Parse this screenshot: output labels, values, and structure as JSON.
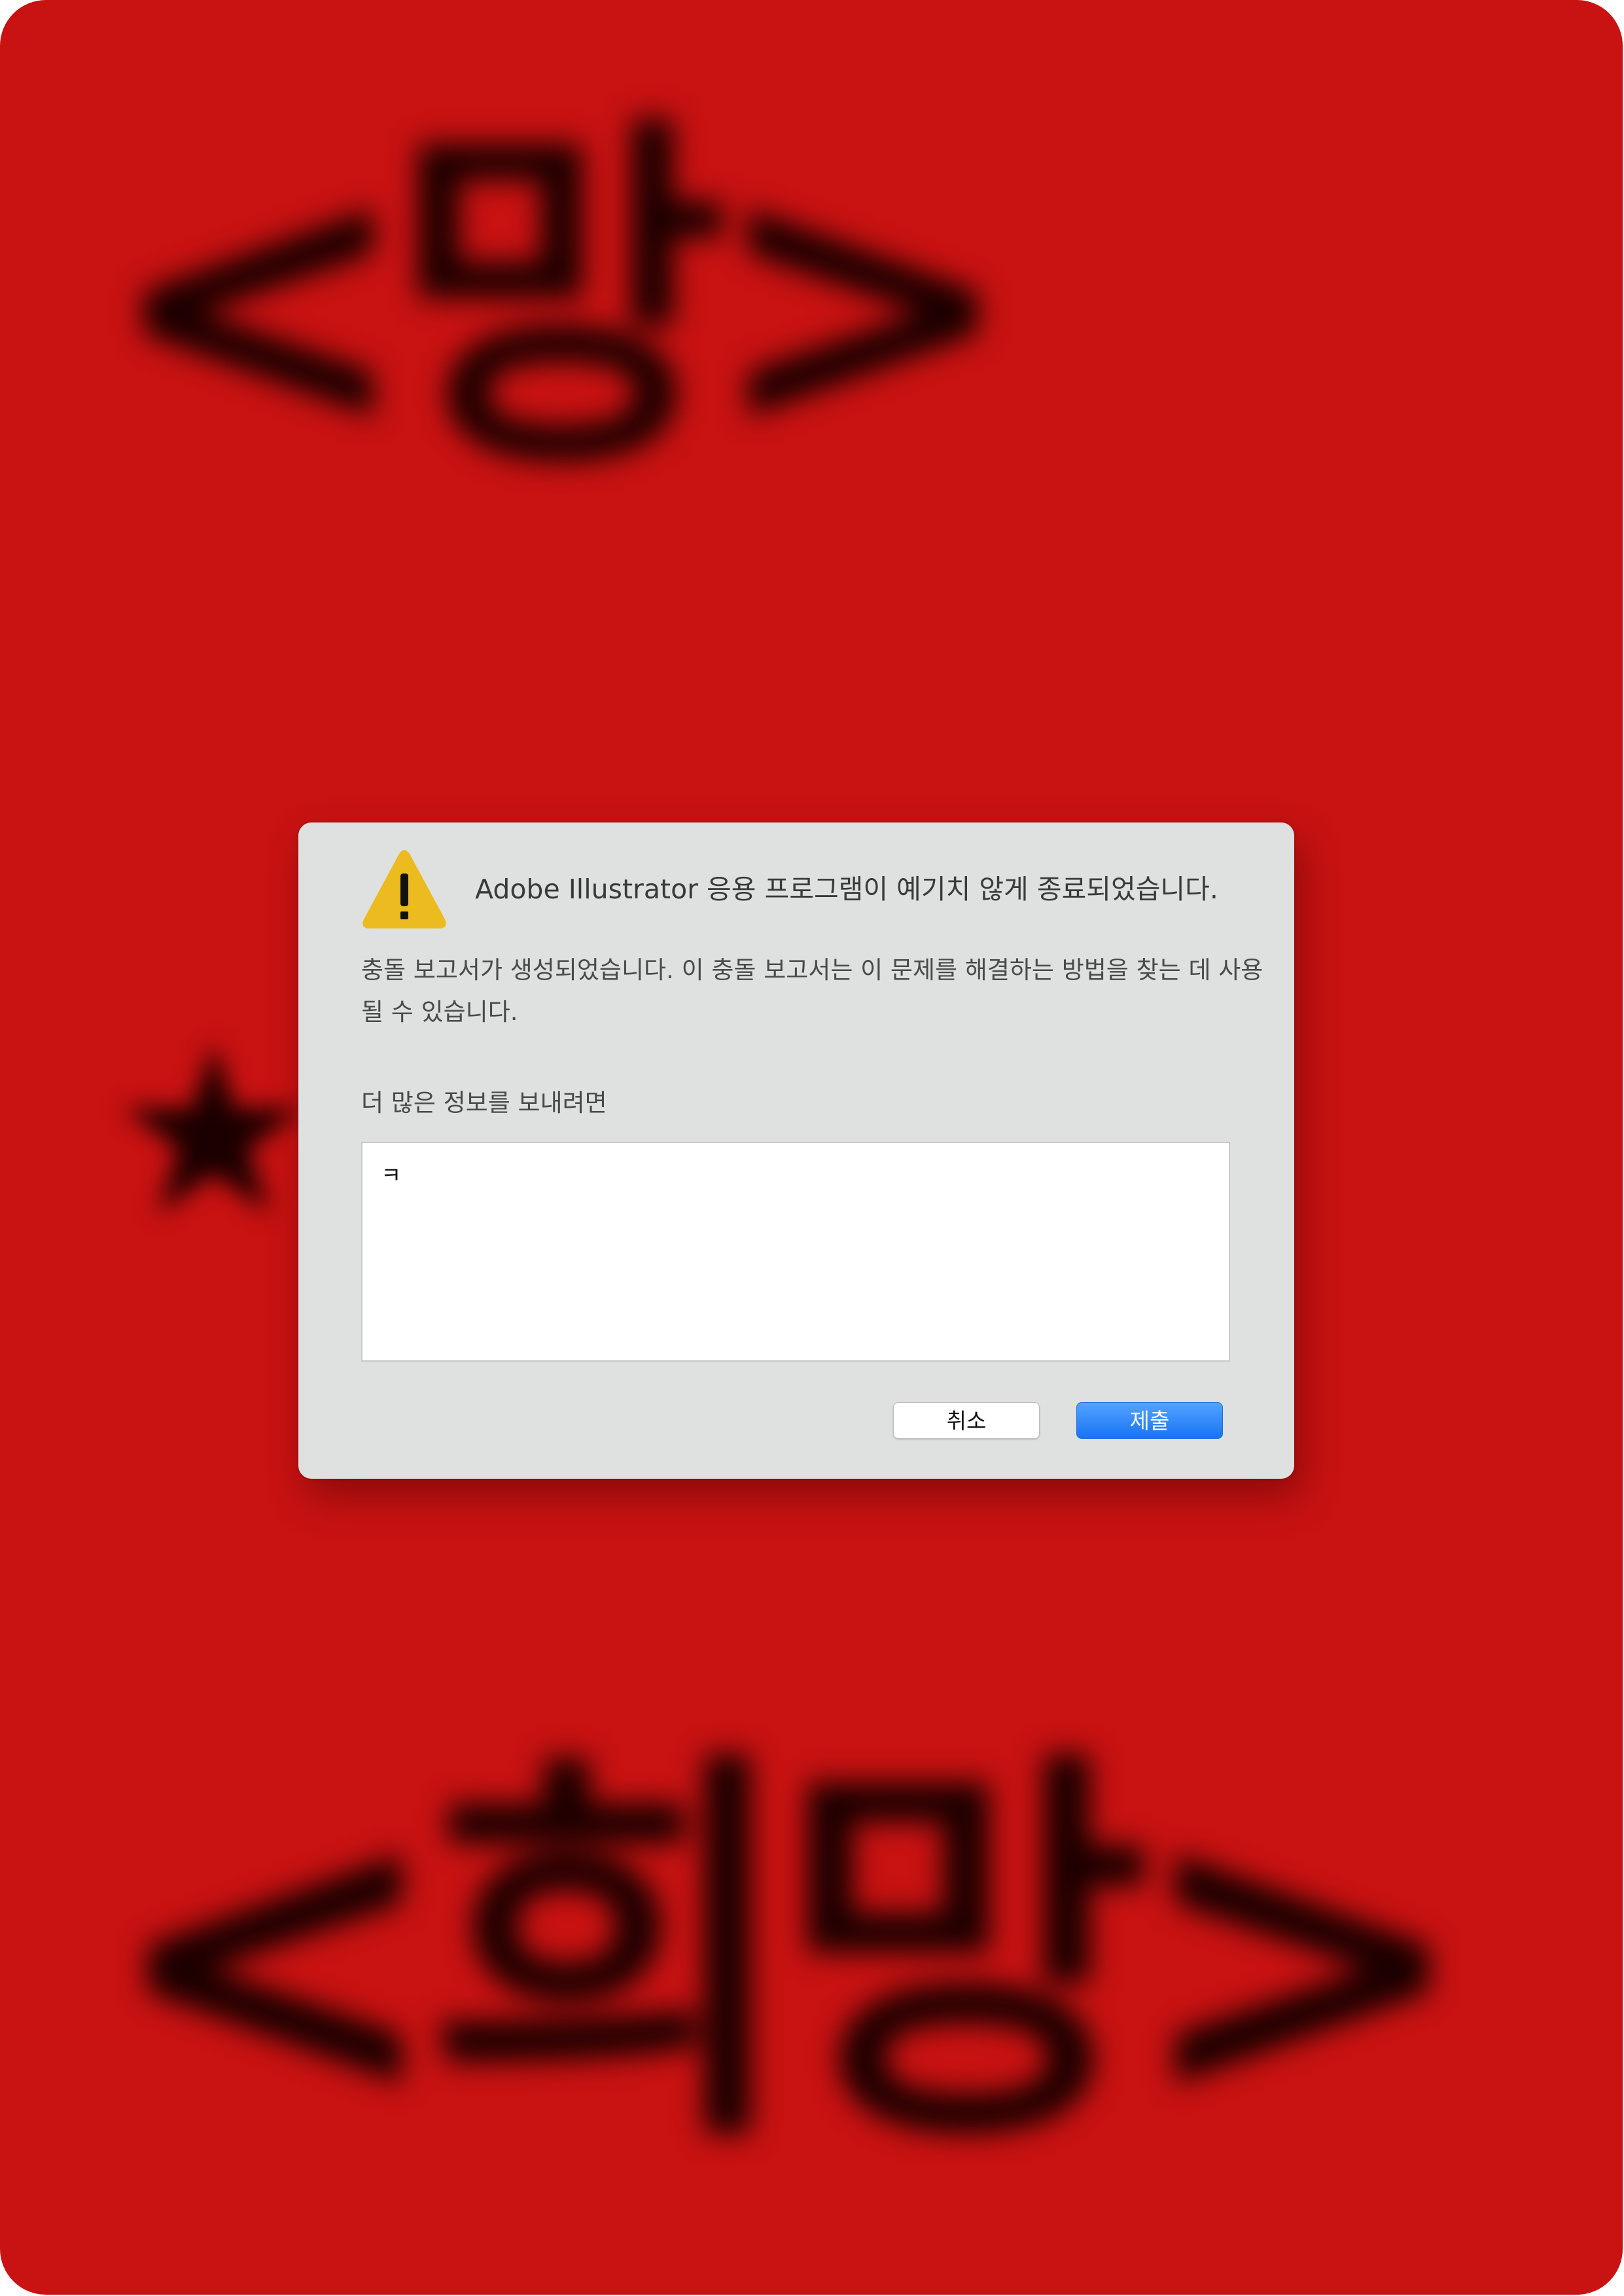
{
  "background": {
    "color": "#c91212",
    "blurred_top_text": "<망>",
    "blurred_star": "★",
    "blurred_bottom_text": "<희망>"
  },
  "dialog": {
    "icon": "warning-triangle-icon",
    "icon_color": "#ebbb1f",
    "title": "Adobe Illustrator 응용 프로그램이 예기치 않게 종료되었습니다.",
    "message": "충돌 보고서가 생성되었습니다. 이 충돌 보고서는 이 문제를 해결하는 방법을 찾는 데 사용될 수 있습니다.",
    "more_info_label": "더 많은 정보를 보내려면",
    "textarea_value": "ㅋ",
    "cancel_label": "취소",
    "submit_label": "제출",
    "submit_color": "#1a7cf5"
  }
}
